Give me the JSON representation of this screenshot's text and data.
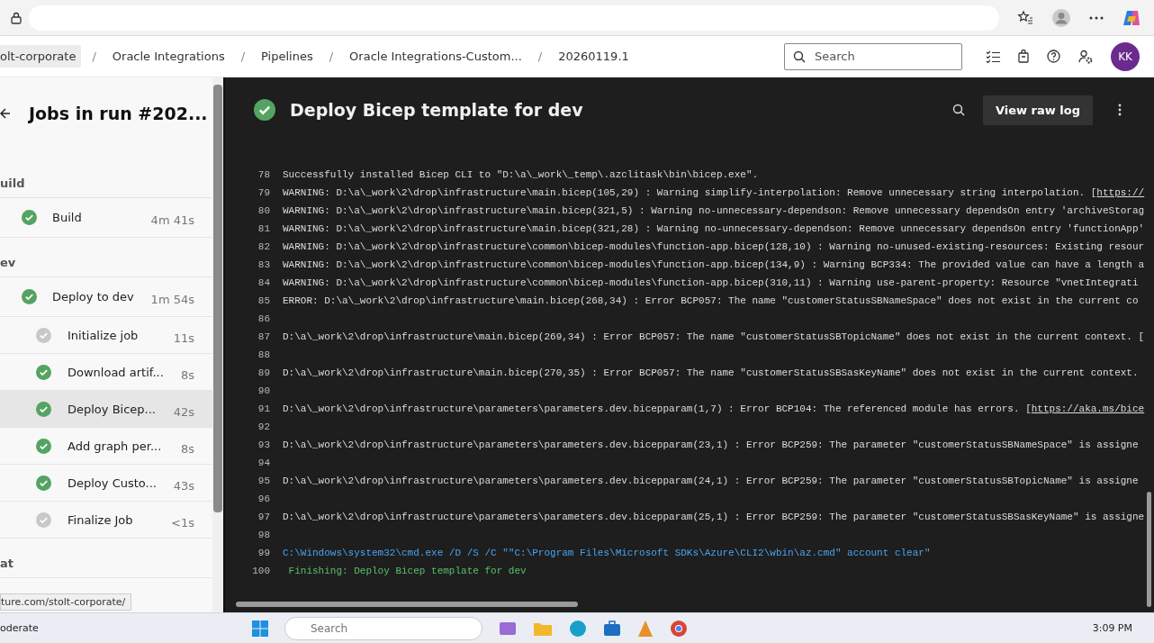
{
  "header": {
    "breadcrumbs": [
      {
        "label": "olt-corporate",
        "kind": "chip"
      },
      {
        "label": "/",
        "kind": "separator"
      },
      {
        "label": "Oracle Integrations",
        "kind": "link"
      },
      {
        "label": "/",
        "kind": "separator"
      },
      {
        "label": "Pipelines",
        "kind": "link"
      },
      {
        "label": "/",
        "kind": "separator"
      },
      {
        "label": "Oracle Integrations-Custom...",
        "kind": "link"
      },
      {
        "label": "/",
        "kind": "separator"
      },
      {
        "label": "20260119.1",
        "kind": "link"
      }
    ],
    "search": {
      "placeholder": "Search"
    },
    "avatar": "KK"
  },
  "jobs_panel": {
    "title": "Jobs in run #202...",
    "stages": [
      {
        "label": "uild",
        "jobs": [
          {
            "name": "Build",
            "duration": "4m 41s",
            "succeeded": true,
            "selected": false
          }
        ]
      },
      {
        "label": "ev",
        "jobs": [
          {
            "name": "Deploy to dev",
            "duration": "1m 54s",
            "succeeded": true,
            "selected": false,
            "children": [
              {
                "name": "Initialize job",
                "duration": "11s",
                "succeeded": false,
                "selected": false
              },
              {
                "name": "Download artif...",
                "duration": "8s",
                "succeeded": true,
                "selected": false
              },
              {
                "name": "Deploy Bicep...",
                "duration": "42s",
                "succeeded": true,
                "selected": true
              },
              {
                "name": "Add graph per...",
                "duration": "8s",
                "succeeded": true,
                "selected": false
              },
              {
                "name": "Deploy Custo...",
                "duration": "43s",
                "succeeded": true,
                "selected": false
              },
              {
                "name": "Finalize Job",
                "duration": "<1s",
                "succeeded": false,
                "selected": false
              }
            ]
          }
        ]
      },
      {
        "label": "at"
      }
    ],
    "status_link": "ture.com/stolt-corporate/"
  },
  "log": {
    "title": "Deploy Bicep template for dev",
    "succeeded": true,
    "button": "View raw log",
    "lines": [
      {
        "no": "78",
        "kind": "plain",
        "text": "Successfully installed Bicep CLI to \"D:\\a\\_work\\_temp\\.azclitask\\bin\\bicep.exe\"."
      },
      {
        "no": "79",
        "kind": "plain",
        "text": "WARNING: D:\\a\\_work\\2\\drop\\infrastructure\\main.bicep(105,29) : Warning simplify-interpolation: Remove unnecessary string interpolation. [",
        "link": "https://"
      },
      {
        "no": "80",
        "kind": "plain",
        "text": "WARNING: D:\\a\\_work\\2\\drop\\infrastructure\\main.bicep(321,5) : Warning no-unnecessary-dependson: Remove unnecessary dependsOn entry 'archiveStorag"
      },
      {
        "no": "81",
        "kind": "plain",
        "text": "WARNING: D:\\a\\_work\\2\\drop\\infrastructure\\main.bicep(321,28) : Warning no-unnecessary-dependson: Remove unnecessary dependsOn entry 'functionApp'"
      },
      {
        "no": "82",
        "kind": "plain",
        "text": "WARNING: D:\\a\\_work\\2\\drop\\infrastructure\\common\\bicep-modules\\function-app.bicep(128,10) : Warning no-unused-existing-resources: Existing resour"
      },
      {
        "no": "83",
        "kind": "plain",
        "text": "WARNING: D:\\a\\_work\\2\\drop\\infrastructure\\common\\bicep-modules\\function-app.bicep(134,9) : Warning BCP334: The provided value can have a length a"
      },
      {
        "no": "84",
        "kind": "plain",
        "text": "WARNING: D:\\a\\_work\\2\\drop\\infrastructure\\common\\bicep-modules\\function-app.bicep(310,11) : Warning use-parent-property: Resource \"vnetIntegrati"
      },
      {
        "no": "85",
        "kind": "plain",
        "text": "ERROR: D:\\a\\_work\\2\\drop\\infrastructure\\main.bicep(268,34) : Error BCP057: The name \"customerStatusSBNameSpace\" does not exist in the current co"
      },
      {
        "no": "86"
      },
      {
        "no": "87",
        "kind": "plain",
        "text": "D:\\a\\_work\\2\\drop\\infrastructure\\main.bicep(269,34) : Error BCP057: The name \"customerStatusSBTopicName\" does not exist in the current context. ["
      },
      {
        "no": "88"
      },
      {
        "no": "89",
        "kind": "plain",
        "text": "D:\\a\\_work\\2\\drop\\infrastructure\\main.bicep(270,35) : Error BCP057: The name \"customerStatusSBSasKeyName\" does not exist in the current context."
      },
      {
        "no": "90"
      },
      {
        "no": "91",
        "kind": "plain",
        "text": "D:\\a\\_work\\2\\drop\\infrastructure\\parameters\\parameters.dev.bicepparam(1,7) : Error BCP104: The referenced module has errors. [",
        "link": "https://aka.ms/bice"
      },
      {
        "no": "92"
      },
      {
        "no": "93",
        "kind": "plain",
        "text": "D:\\a\\_work\\2\\drop\\infrastructure\\parameters\\parameters.dev.bicepparam(23,1) : Error BCP259: The parameter \"customerStatusSBNameSpace\" is assigne"
      },
      {
        "no": "94"
      },
      {
        "no": "95",
        "kind": "plain",
        "text": "D:\\a\\_work\\2\\drop\\infrastructure\\parameters\\parameters.dev.bicepparam(24,1) : Error BCP259: The parameter \"customerStatusSBTopicName\" is assigne"
      },
      {
        "no": "96"
      },
      {
        "no": "97",
        "kind": "plain",
        "text": "D:\\a\\_work\\2\\drop\\infrastructure\\parameters\\parameters.dev.bicepparam(25,1) : Error BCP259: The parameter \"customerStatusSBSasKeyName\" is assigne"
      },
      {
        "no": "98"
      },
      {
        "no": "99",
        "kind": "command",
        "text": "C:\\Windows\\system32\\cmd.exe /D /S /C \"\"C:\\Program Files\\Microsoft SDKs\\Azure\\CLI2\\wbin\\az.cmd\" account clear\""
      },
      {
        "no": "100",
        "kind": "section",
        "text": " Finishing: Deploy Bicep template for dev"
      }
    ]
  },
  "taskbar": {
    "weather": "oderate",
    "search": {
      "placeholder": "Search"
    },
    "time": "3:09 PM"
  }
}
